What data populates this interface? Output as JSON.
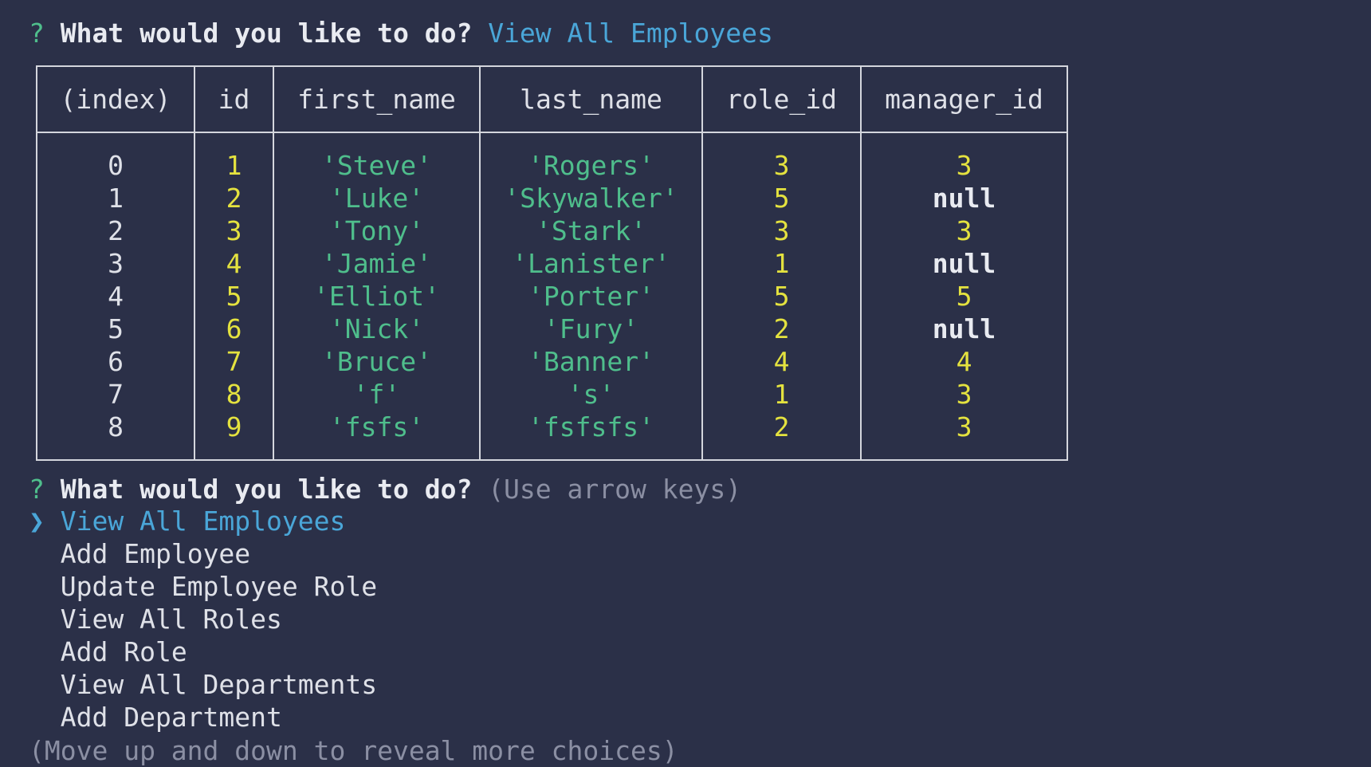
{
  "prompt1": {
    "marker": "?",
    "question": "What would you like to do?",
    "answer": "View All Employees"
  },
  "table": {
    "headers": [
      "(index)",
      "id",
      "first_name",
      "last_name",
      "role_id",
      "manager_id"
    ],
    "rows": [
      {
        "index": "0",
        "id": "1",
        "first_name": "'Steve'",
        "last_name": "'Rogers'",
        "role_id": "3",
        "manager_id": "3"
      },
      {
        "index": "1",
        "id": "2",
        "first_name": "'Luke'",
        "last_name": "'Skywalker'",
        "role_id": "5",
        "manager_id": "null"
      },
      {
        "index": "2",
        "id": "3",
        "first_name": "'Tony'",
        "last_name": "'Stark'",
        "role_id": "3",
        "manager_id": "3"
      },
      {
        "index": "3",
        "id": "4",
        "first_name": "'Jamie'",
        "last_name": "'Lanister'",
        "role_id": "1",
        "manager_id": "null"
      },
      {
        "index": "4",
        "id": "5",
        "first_name": "'Elliot'",
        "last_name": "'Porter'",
        "role_id": "5",
        "manager_id": "5"
      },
      {
        "index": "5",
        "id": "6",
        "first_name": "'Nick'",
        "last_name": "'Fury'",
        "role_id": "2",
        "manager_id": "null"
      },
      {
        "index": "6",
        "id": "7",
        "first_name": "'Bruce'",
        "last_name": "'Banner'",
        "role_id": "4",
        "manager_id": "4"
      },
      {
        "index": "7",
        "id": "8",
        "first_name": "'f'",
        "last_name": "'s'",
        "role_id": "1",
        "manager_id": "3"
      },
      {
        "index": "8",
        "id": "9",
        "first_name": "'fsfs'",
        "last_name": "'fsfsfs'",
        "role_id": "2",
        "manager_id": "3"
      }
    ]
  },
  "prompt2": {
    "marker": "?",
    "question": "What would you like to do?",
    "hint": "(Use arrow keys)",
    "pointer": "❯",
    "choices": [
      "View All Employees",
      "Add Employee",
      "Update Employee Role",
      "View All Roles",
      "Add Role",
      "View All Departments",
      "Add Department"
    ],
    "selected_index": 0,
    "footer": "(Move up and down to reveal more choices)"
  },
  "colors": {
    "background": "#2b3048",
    "prompt_marker": "#4fbe8c",
    "answer": "#4aa6d8",
    "number": "#e4e23f",
    "string": "#4fbe8c",
    "hint": "#8b8fa3"
  }
}
